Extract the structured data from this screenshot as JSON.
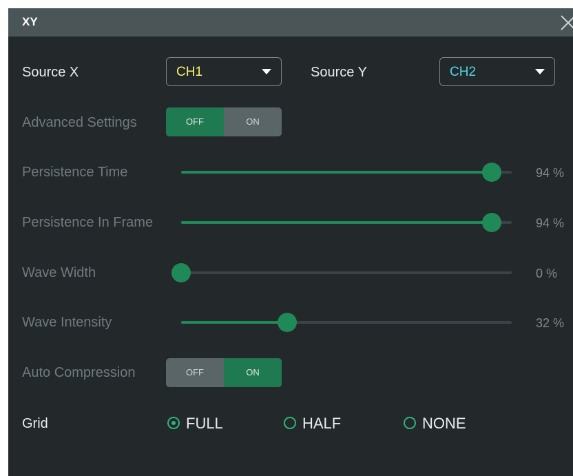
{
  "dialog": {
    "title": "XY",
    "close_icon": "close-icon"
  },
  "source_x": {
    "label": "Source X",
    "value": "CH1",
    "value_color": "#f2f06a"
  },
  "source_y": {
    "label": "Source Y",
    "value": "CH2",
    "value_color": "#4fd6e6"
  },
  "advanced": {
    "label": "Advanced Settings",
    "off": "OFF",
    "on": "ON",
    "state": "OFF"
  },
  "sliders": [
    {
      "label": "Persistence Time",
      "value": 94,
      "value_text": "94 %"
    },
    {
      "label": "Persistence In Frame",
      "value": 94,
      "value_text": "94 %"
    },
    {
      "label": "Wave Width",
      "value": 0,
      "value_text": "0 %"
    },
    {
      "label": "Wave Intensity",
      "value": 32,
      "value_text": "32 %"
    }
  ],
  "auto_compression": {
    "label": "Auto Compression",
    "off": "OFF",
    "on": "ON",
    "state": "ON"
  },
  "grid": {
    "label": "Grid",
    "options": [
      {
        "label": "FULL",
        "selected": true
      },
      {
        "label": "HALF",
        "selected": false
      },
      {
        "label": "NONE",
        "selected": false
      }
    ]
  },
  "colors": {
    "accent": "#1f8a57",
    "panel": "#23292b",
    "titlebar": "#4b5457"
  }
}
